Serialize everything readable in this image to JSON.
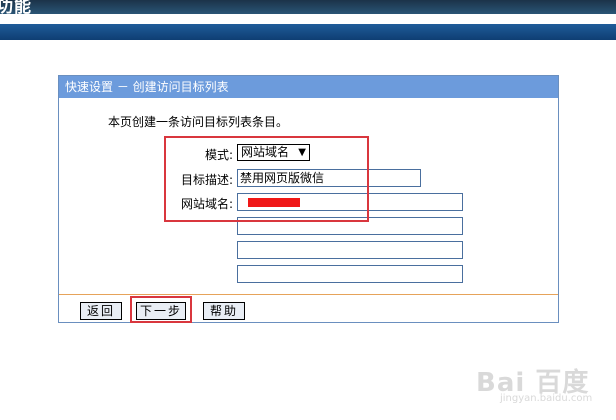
{
  "banner": {
    "title": "功能"
  },
  "panel": {
    "header": "快速设置 － 创建访问目标列表",
    "intro": "本页创建一条访问目标列表条目。",
    "fields": {
      "mode_label": "模式:",
      "mode_value": "网站域名",
      "desc_label": "目标描述:",
      "desc_value": "禁用网页版微信",
      "domain_label": "网站域名:"
    },
    "buttons": {
      "back": "返回",
      "next": "下一步",
      "help": "帮助"
    }
  },
  "watermark": {
    "brand": "Bai  百度",
    "sub": "jingyan.baidu.com"
  },
  "colors": {
    "highlight": "#d9363e",
    "header": "#6c9bdc",
    "redaction": "#f01818"
  }
}
